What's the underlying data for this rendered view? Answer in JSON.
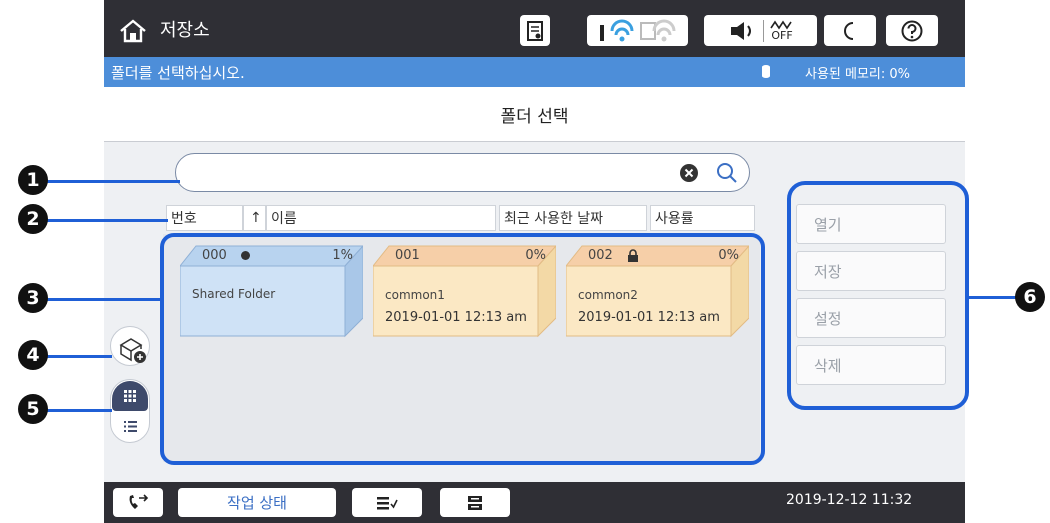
{
  "topbar": {
    "title": "저장소",
    "icons": [
      "home-icon",
      "ink-icon",
      "wifi-icon",
      "wifi-direct-icon",
      "volume-icon",
      "quiet-off-icon",
      "sleep-icon",
      "help-icon"
    ],
    "quiet_label": "OFF"
  },
  "message": {
    "text": "폴더를 선택하십시오.",
    "memory_label": "사용된 메모리: 0%"
  },
  "section": {
    "title": "폴더 선택"
  },
  "search": {
    "value": "",
    "placeholder": ""
  },
  "columns": {
    "number": "번호",
    "sort_arrow": "↑",
    "name": "이름",
    "last_used": "최근 사용한 날짜",
    "usage": "사용률"
  },
  "folders": [
    {
      "number": "000",
      "usage": "1%",
      "name": "Shared Folder",
      "date": "",
      "color": "#cfe2f6"
    },
    {
      "number": "001",
      "usage": "0%",
      "name": "common1",
      "date": "2019-01-01 12:13 am",
      "color": "#fbe8c4"
    },
    {
      "number": "002",
      "usage": "0%",
      "name": "common2",
      "date": "2019-01-01 12:13 am",
      "color": "#fbe8c4"
    }
  ],
  "actions": {
    "open": "열기",
    "save": "저장",
    "settings": "설정",
    "delete": "삭제"
  },
  "bottom": {
    "job_status": "작업 상태",
    "datetime": "2019-12-12 11:32"
  },
  "callouts": [
    "1",
    "2",
    "3",
    "4",
    "5",
    "6"
  ],
  "colors": {
    "topbar": "#2f2f35",
    "message_bar": "#4d8ed9",
    "highlight": "#1f5fd6"
  }
}
